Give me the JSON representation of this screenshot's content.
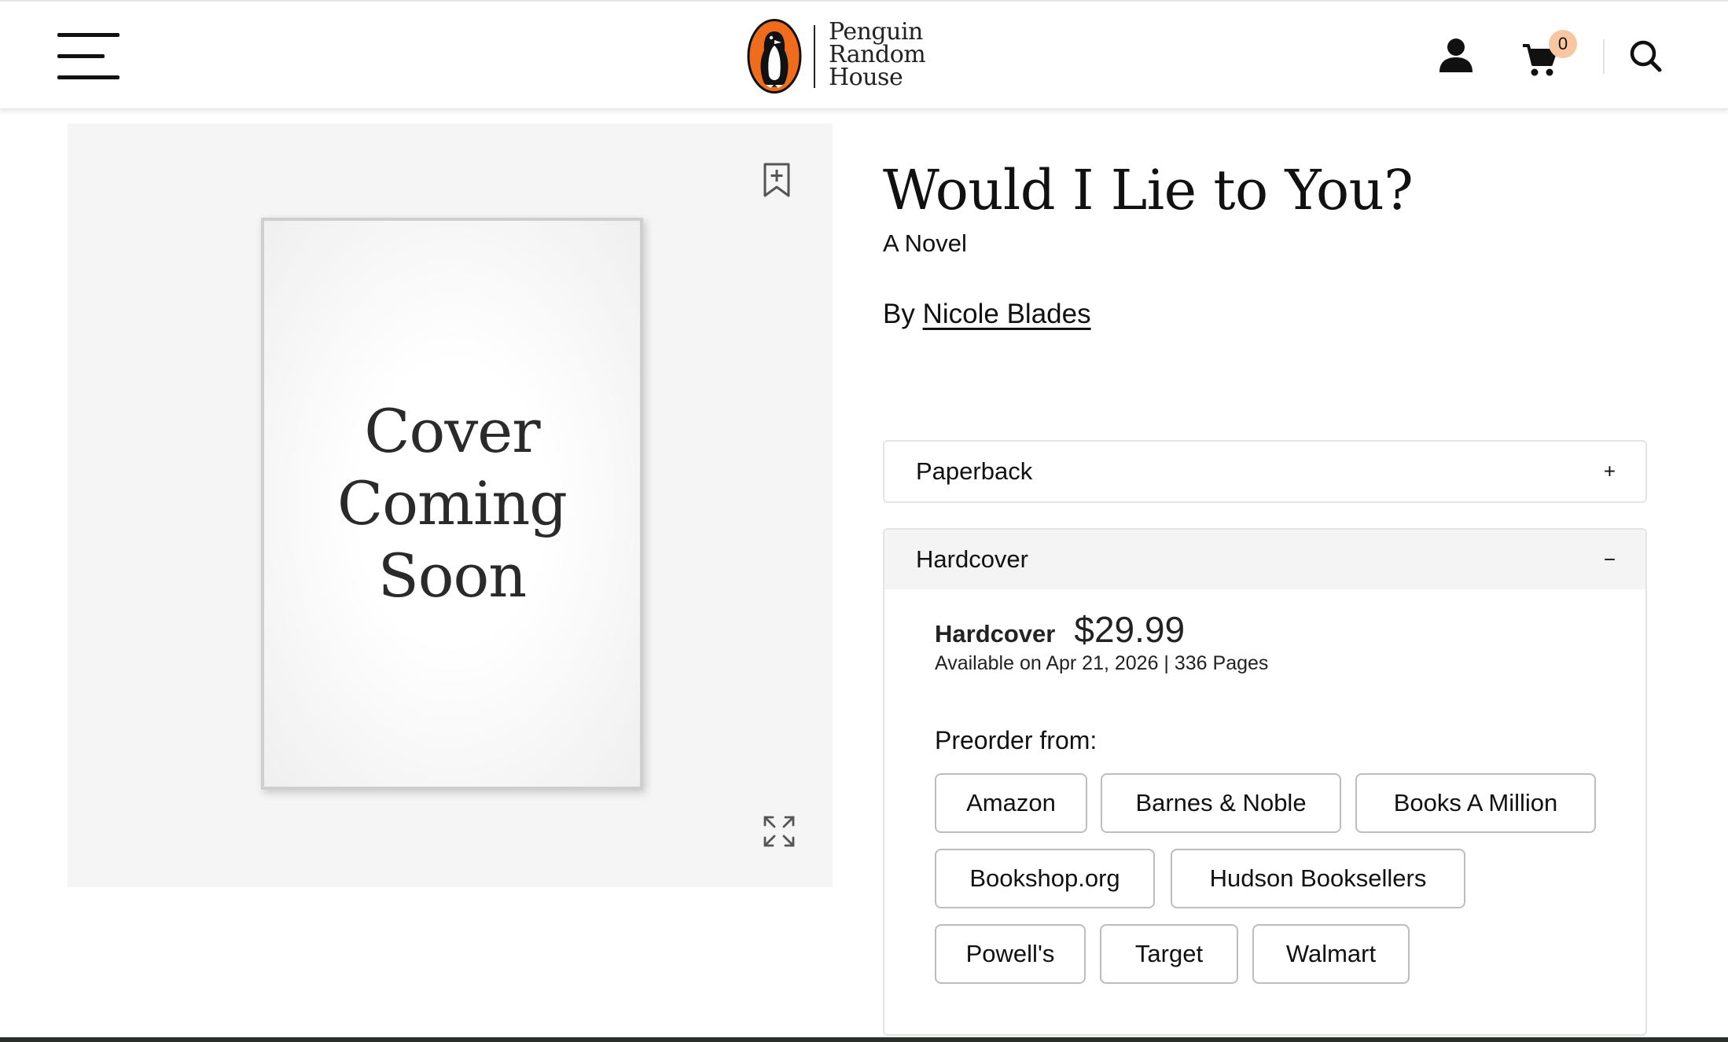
{
  "header": {
    "logo_text": "Penguin\nRandom\nHouse",
    "cart_count": "0",
    "icons": [
      "menu-icon",
      "user-icon",
      "cart-icon",
      "search-icon"
    ]
  },
  "colors": {
    "logo_orange": "#ef6c1c",
    "cart_badge": "#f8c7a1",
    "cover_panel_bg": "#f5f5f5"
  },
  "cover": {
    "placeholder_text": "Cover\nComing\nSoon"
  },
  "book": {
    "title": "Would I Lie to You?",
    "subtitle": "A Novel",
    "by_label": "By",
    "author": "Nicole Blades"
  },
  "formats": {
    "paperback": {
      "label": "Paperback",
      "toggle": "+"
    },
    "hardcover": {
      "label": "Hardcover",
      "toggle": "−",
      "format_name": "Hardcover",
      "price": "$29.99",
      "availability": "Available on Apr 21, 2026 | 336 Pages",
      "preorder_label": "Preorder from:",
      "retailers": [
        "Amazon",
        "Barnes & Noble",
        "Books A Million",
        "Bookshop.org",
        "Hudson Booksellers",
        "Powell's",
        "Target",
        "Walmart"
      ]
    }
  }
}
